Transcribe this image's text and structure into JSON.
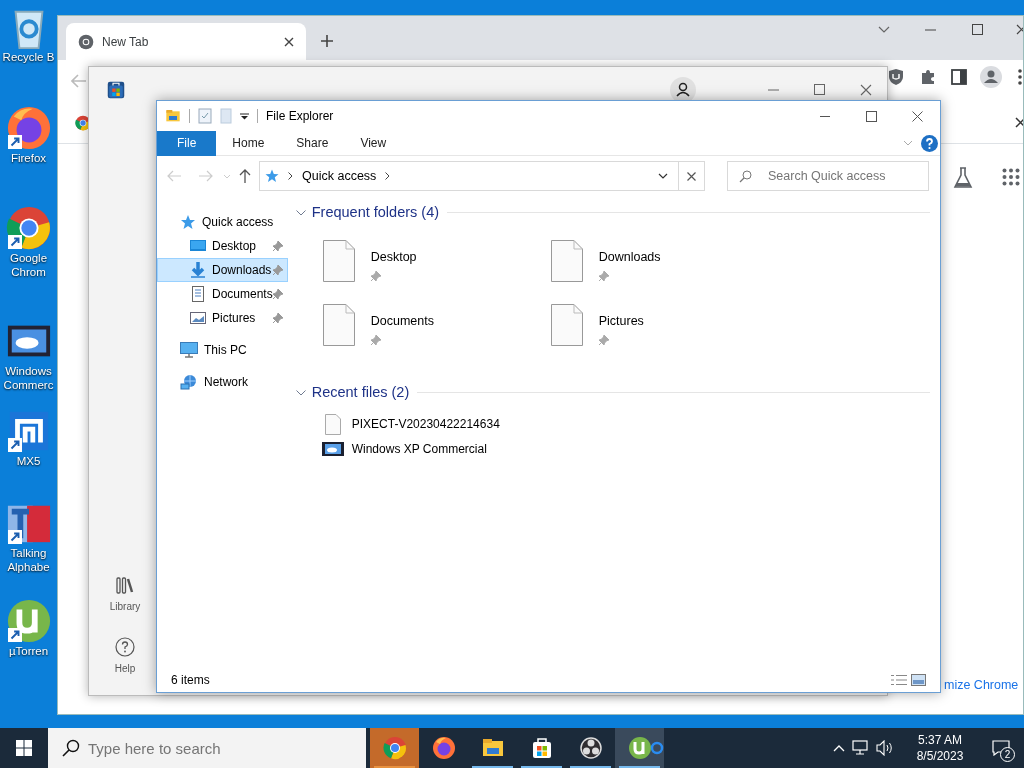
{
  "desktop_icons": [
    {
      "label": "Recycle B",
      "kind": "recycle",
      "shortcut": false
    },
    {
      "label": "Firefox",
      "kind": "firefox",
      "shortcut": true
    },
    {
      "label": "Google Chrom",
      "kind": "chrome",
      "shortcut": true
    },
    {
      "label": "Windows Commerc",
      "kind": "video",
      "shortcut": false
    },
    {
      "label": "MX5",
      "kind": "maxthon",
      "shortcut": true
    },
    {
      "label": "Talking Alphabe",
      "kind": "alphabet",
      "shortcut": true
    },
    {
      "label": "µTorren",
      "kind": "utorrent",
      "shortcut": true
    }
  ],
  "browser": {
    "tabs": [
      {
        "title": "New Tab",
        "selected": true
      }
    ],
    "link": "mize Chrome"
  },
  "store": {
    "nav": [
      {
        "label": "Library",
        "kind": "library"
      },
      {
        "label": "Help",
        "kind": "help"
      }
    ]
  },
  "explorer": {
    "title": "File Explorer",
    "ribbon_tabs": [
      {
        "label": "File",
        "selected": true
      },
      {
        "label": "Home",
        "selected": false
      },
      {
        "label": "Share",
        "selected": false
      },
      {
        "label": "View",
        "selected": false
      }
    ],
    "address": [
      "Quick access"
    ],
    "search": {
      "placeholder": "Search Quick access"
    },
    "nav": [
      {
        "label": "Quick access",
        "kind": "star",
        "selected": false,
        "children": [
          {
            "label": "Desktop",
            "kind": "desktop",
            "pinned": true,
            "selected": false
          },
          {
            "label": "Downloads",
            "kind": "download",
            "pinned": true,
            "selected": true
          },
          {
            "label": "Documents",
            "kind": "document",
            "pinned": true,
            "selected": false
          },
          {
            "label": "Pictures",
            "kind": "picture",
            "pinned": true,
            "selected": false
          }
        ]
      },
      {
        "label": "This PC",
        "kind": "pc",
        "selected": false
      },
      {
        "label": "Network",
        "kind": "network",
        "selected": false
      }
    ],
    "groups": [
      {
        "title": "Frequent folders (4)",
        "expanded": true,
        "kind": "tiles",
        "items": [
          {
            "name": "Desktop",
            "pinned": true
          },
          {
            "name": "Downloads",
            "pinned": true
          },
          {
            "name": "Documents",
            "pinned": true
          },
          {
            "name": "Pictures",
            "pinned": true
          }
        ]
      },
      {
        "title": "Recent files (2)",
        "expanded": true,
        "kind": "list",
        "items": [
          {
            "name": "PIXECT-V20230422214634",
            "kind": "file"
          },
          {
            "name": "Windows XP Commercial",
            "kind": "video"
          }
        ]
      }
    ],
    "status": "6 items"
  },
  "taskbar": {
    "search_placeholder": "Type here to search",
    "apps": [
      {
        "kind": "chrome",
        "running": true,
        "flashing": true,
        "hover": false
      },
      {
        "kind": "firefox",
        "running": false,
        "flashing": false,
        "hover": false
      },
      {
        "kind": "explorer",
        "running": true,
        "flashing": false,
        "hover": false
      },
      {
        "kind": "store",
        "running": true,
        "flashing": false,
        "hover": false
      },
      {
        "kind": "obs",
        "running": true,
        "flashing": false,
        "hover": false
      },
      {
        "kind": "utorrent",
        "running": true,
        "flashing": false,
        "hover": true
      }
    ],
    "time": "5:37 AM",
    "date": "8/5/2023",
    "notifications": "2"
  }
}
